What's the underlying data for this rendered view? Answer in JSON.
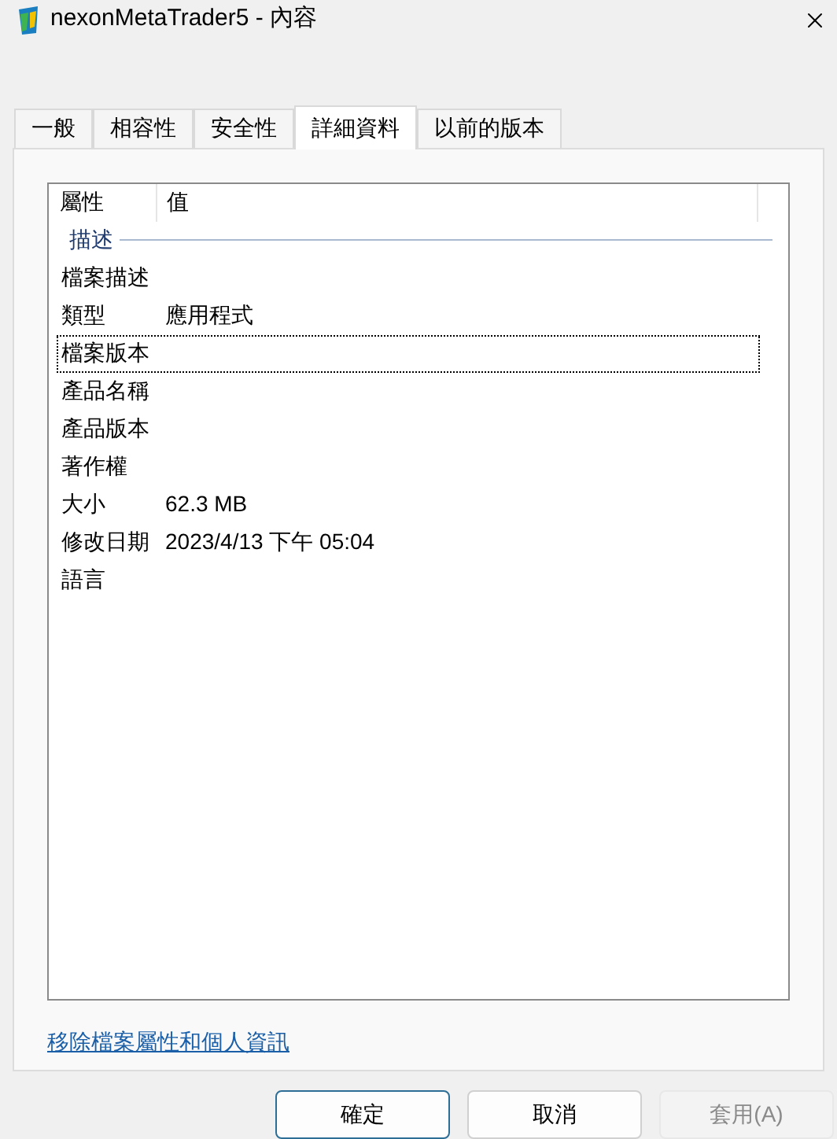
{
  "window": {
    "title": "nexonMetaTrader5 - 內容"
  },
  "tabs": [
    {
      "label": "一般",
      "selected": false
    },
    {
      "label": "相容性",
      "selected": false
    },
    {
      "label": "安全性",
      "selected": false
    },
    {
      "label": "詳細資料",
      "selected": true
    },
    {
      "label": "以前的版本",
      "selected": false
    }
  ],
  "table": {
    "columns": [
      "屬性",
      "值"
    ],
    "group": "描述",
    "rows": [
      {
        "name": "檔案描述",
        "value": null,
        "focused": false
      },
      {
        "name": "類型",
        "value": "應用程式",
        "focused": false
      },
      {
        "name": "檔案版本",
        "value": null,
        "focused": true
      },
      {
        "name": "產品名稱",
        "value": null,
        "focused": false
      },
      {
        "name": "產品版本",
        "value": null,
        "focused": false
      },
      {
        "name": "著作權",
        "value": null,
        "focused": false
      },
      {
        "name": "大小",
        "value": "62.3 MB",
        "focused": false
      },
      {
        "name": "修改日期",
        "value": "2023/4/13 下午 05:04",
        "focused": false
      },
      {
        "name": "語言",
        "value": null,
        "focused": false
      }
    ]
  },
  "link": "移除檔案屬性和個人資訊",
  "buttons": [
    {
      "label": "確定",
      "default": true,
      "disabled": false
    },
    {
      "label": "取消",
      "default": false,
      "disabled": false
    },
    {
      "label": "套用(A)",
      "default": false,
      "disabled": true
    }
  ]
}
